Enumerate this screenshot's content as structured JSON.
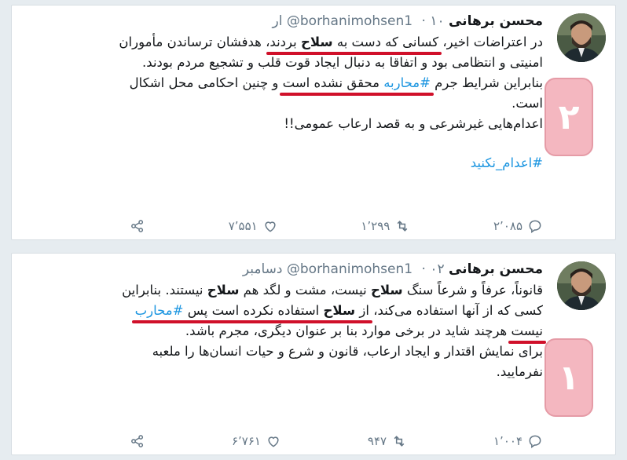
{
  "tweets": [
    {
      "name": "محسن برهانی",
      "handle": "@borhanimohsen1",
      "date": "۱۰ ار",
      "lines": [
        [
          "در اعتراضات اخیر، ",
          "کسانی که دست به ",
          "سلاح",
          " بردند",
          "، هدفشان ترساندن مأموران"
        ],
        [
          "امنیتی و انتظامی بود و اتفاقا به دنبال ایجاد قوت قلب و تشجیع مردم بودند."
        ],
        [
          "بنابراین شرایط جرم ",
          "#محاربه",
          " محقق نشده است",
          " و چنین احکامی محل اشکال"
        ],
        [
          "است."
        ],
        [
          "اعدام‌هایی غیرشرعی و به قصد ارعاب عمومی!!"
        ]
      ],
      "hashtag": "#اعدام_نکنید",
      "reply_count": "۲٬۰۸۵",
      "retweet_count": "۱٬۲۹۹",
      "like_count": "۷٬۵۵۱",
      "badge": "۲"
    },
    {
      "name": "محسن برهانی",
      "handle": "@borhanimohsen1",
      "date": "۰۲ دسامبر",
      "lines": [
        [
          "قانوناً، عرفاً و شرعاً سنگ ",
          "سلاح",
          " نیست، مشت و لگد هم ",
          "سلاح",
          " نیستند. بنابراین"
        ],
        [
          "کسی که از آنها استفاده می‌کند، ",
          "از ",
          "سلاح",
          " استفاده نکرده است پس ",
          "#محارب"
        ],
        [
          "نیست",
          " هرچند شاید در برخی موارد بنا بر عنوان دیگری، مجرم باشد."
        ],
        [
          "برای نمایش اقتدار و ایجاد ارعاب، قانون و شرع و حیات انسان‌ها را ملعبه"
        ],
        [
          "نفرمایید."
        ]
      ],
      "reply_count": "۱٬۰۰۴",
      "retweet_count": "۹۴۷",
      "like_count": "۶٬۷۶۱",
      "badge": "۱"
    }
  ],
  "colors": {
    "hashtag": "#1b95e0",
    "underline": "#d0102a",
    "badge_bg": "#f4b7c0"
  },
  "icons": [
    "reply-icon",
    "retweet-icon",
    "like-icon",
    "share-icon"
  ]
}
